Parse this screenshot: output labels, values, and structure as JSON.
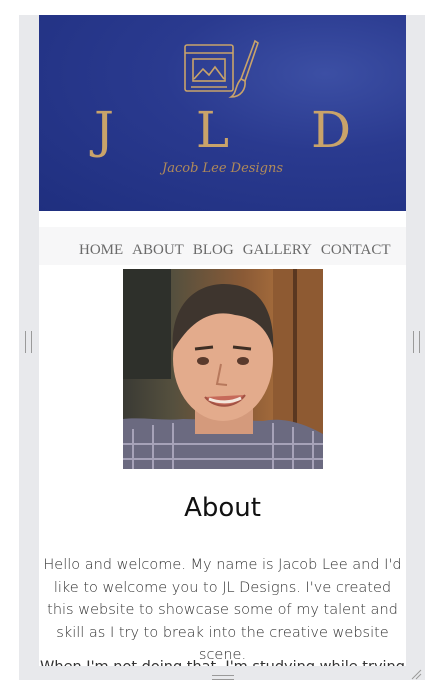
{
  "header": {
    "logo_letters": "J L D",
    "logo_script": "Jacob Lee Designs"
  },
  "nav": {
    "items": [
      "HOME",
      "ABOUT",
      "BLOG",
      "GALLERY",
      "CONTACT"
    ]
  },
  "profile_photo": {
    "alt": "portrait photo of Jacob Lee"
  },
  "about": {
    "title": "About",
    "paragraph": "Hello and welcome. My name is Jacob Lee and I'd like to welcome you to JL Designs. I've created this website to showcase some of my talent and skill as I try to break into the creative website scene.",
    "paragraph2": "When I'm not doing that, I'm studying while trying"
  },
  "colors": {
    "hero_blue": "#23358a",
    "logo_gold": "#c9a36a",
    "nav_text": "#6a6a6a",
    "frame_gray": "#e8e9ec"
  },
  "icons": {
    "logo": "canvas-with-paintbrush-icon",
    "resize_left": "resize-handle-left-icon",
    "resize_right": "resize-handle-right-icon",
    "resize_bottom": "resize-handle-bottom-icon",
    "resize_corner": "resize-corner-icon"
  }
}
